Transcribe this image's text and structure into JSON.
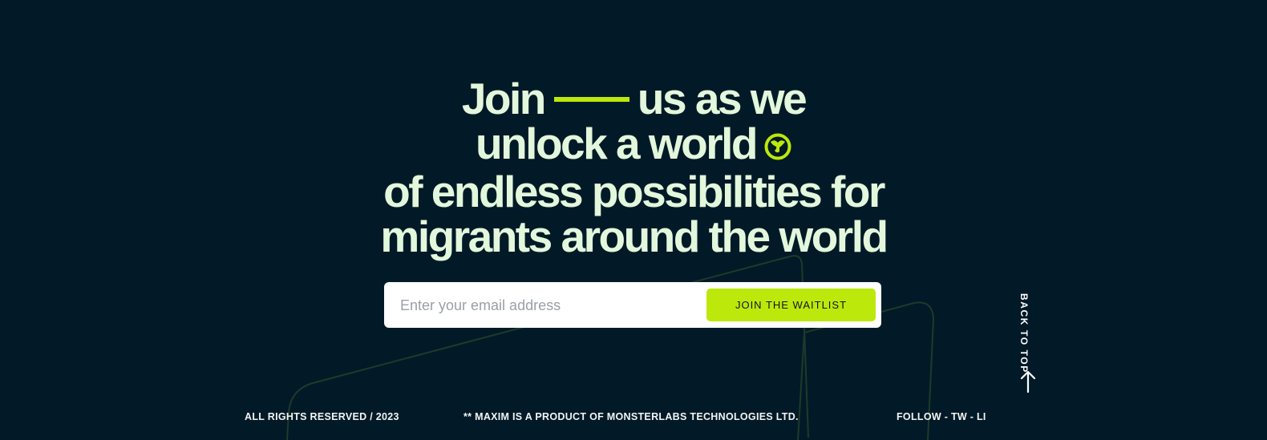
{
  "headline": {
    "line1_start": "Join",
    "line1_end": "us as we",
    "line2": "unlock a world",
    "line3": "of endless possibilities for",
    "line4": "migrants around the world"
  },
  "signup": {
    "email_placeholder": "Enter your email address",
    "email_value": "",
    "button_label": "JOIN THE WAITLIST"
  },
  "back_to_top": "BACK TO TOP",
  "footer": {
    "rights": "ALL RIGHTS RESERVED / 2023",
    "product_note": "** MAXIM IS A PRODUCT OF MONSTERLABS TECHNOLOGIES LTD.",
    "follow": "FOLLOW - TW - LI"
  },
  "colors": {
    "background": "#021a27",
    "headline": "#e3f7dc",
    "accent": "#bde80b",
    "decor_line": "#1e3a2a"
  },
  "icons": [
    "globe-icon",
    "arrow-up-icon"
  ]
}
